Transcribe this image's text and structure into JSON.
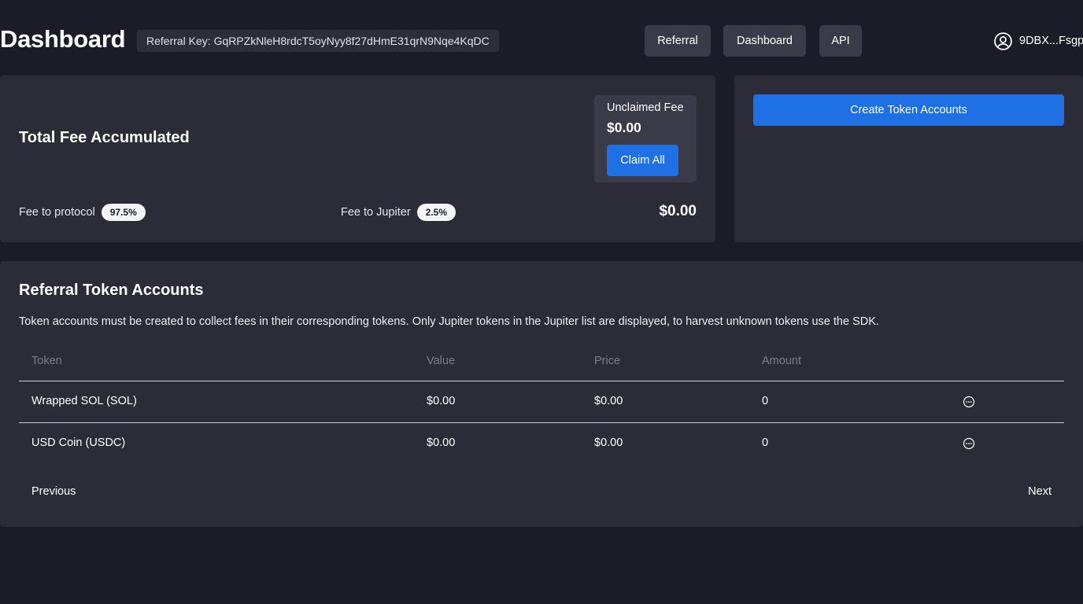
{
  "header": {
    "title": "Dashboard",
    "referral_key_label": "Referral Key:",
    "referral_key": "GqRPZkNleH8rdcT5oyNyy8f27dHmE31qrN9Nqe4KqDC",
    "nav": [
      {
        "label": "Referral"
      },
      {
        "label": "Dashboard"
      },
      {
        "label": "API"
      }
    ],
    "wallet": {
      "label": "9DBX...Fsgp",
      "icon": "user-circle-icon"
    }
  },
  "fee_card": {
    "title": "Total Fee Accumulated",
    "unclaimed_label": "Unclaimed Fee",
    "unclaimed_value": "$0.00",
    "claim_button": "Claim All",
    "protocol_label": "Fee to protocol",
    "protocol_pct": "97.5%",
    "jupiter_label": "Fee to Jupiter",
    "jupiter_pct": "2.5%",
    "total_value": "$0.00"
  },
  "create_card": {
    "button_label": "Create Token Accounts"
  },
  "referral_accounts": {
    "title": "Referral Token Accounts",
    "description": "Token accounts must be created to collect fees in their corresponding tokens. Only Jupiter tokens in the Jupiter list are displayed, to harvest unknown tokens use the SDK.",
    "columns": [
      "Token",
      "Value",
      "Price",
      "Amount"
    ],
    "rows": [
      {
        "token": "Wrapped SOL (SOL)",
        "value": "$0.00",
        "price": "$0.00",
        "amount": "0",
        "action_icon": "more-options-icon"
      },
      {
        "token": "USD Coin (USDC)",
        "value": "$0.00",
        "price": "$0.00",
        "amount": "0",
        "action_icon": "more-options-icon"
      }
    ],
    "pagination": {
      "previous": "Previous",
      "next": "Next"
    }
  },
  "colors": {
    "background": "#1c1c29",
    "card": "#2c2c38",
    "accent": "#1f70e4",
    "nav_button": "#3a3a48"
  }
}
